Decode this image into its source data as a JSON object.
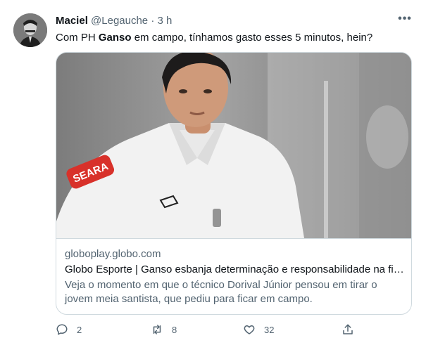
{
  "tweet": {
    "author_name": "Maciel",
    "handle": "@Legauche",
    "separator": "·",
    "time": "3 h",
    "more_label": "•••",
    "text_before": "Com PH ",
    "text_bold": "Ganso",
    "text_after": " em campo, tínhamos gasto esses 5 minutos, hein?"
  },
  "card": {
    "domain": "globoplay.globo.com",
    "title": "Globo Esporte | Ganso esbanja determinação e responsabilidade na fin...",
    "description": "Veja o momento em que o técnico Dorival Júnior pensou em tirar o jovem meia santista, que pediu para ficar em campo.",
    "sponsor_text": "SEARA"
  },
  "actions": {
    "reply_count": "2",
    "retweet_count": "8",
    "like_count": "32"
  },
  "colors": {
    "text_primary": "#0f1419",
    "text_secondary": "#536471",
    "border": "#cfd9de",
    "background": "#ffffff"
  },
  "icons": [
    "reply-icon",
    "retweet-icon",
    "like-icon",
    "share-icon",
    "more-icon"
  ]
}
